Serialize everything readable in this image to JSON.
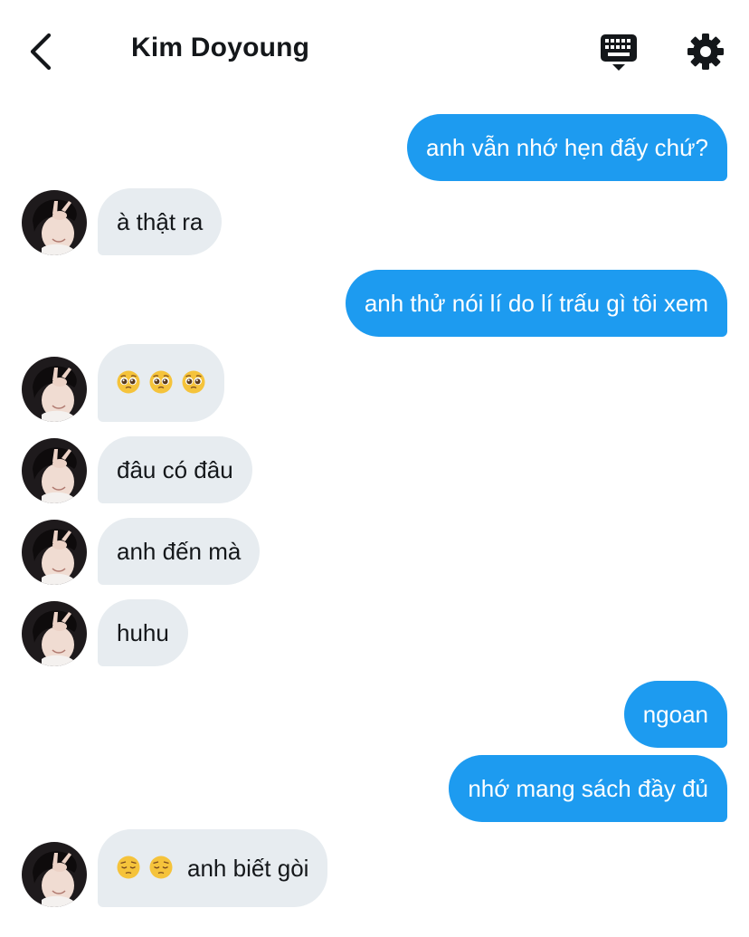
{
  "header": {
    "title": "Kim Doyoung",
    "back_icon": "chevron-left-icon",
    "keyboard_icon": "keyboard-icon",
    "settings_icon": "gear-icon"
  },
  "colors": {
    "outgoing_bubble": "#1d9bf0",
    "incoming_bubble": "#e7ecf0",
    "text_dark": "#14171a"
  },
  "messages": [
    {
      "direction": "outgoing",
      "text": "anh vẫn nhớ hẹn đấy chứ?"
    },
    {
      "direction": "incoming",
      "text": "à thật ra"
    },
    {
      "direction": "outgoing",
      "text": "anh thử nói lí do lí trấu gì tôi xem"
    },
    {
      "direction": "incoming",
      "emojis": [
        "pleading-face",
        "pleading-face",
        "pleading-face"
      ],
      "text": ""
    },
    {
      "direction": "incoming",
      "text": "đâu có đâu"
    },
    {
      "direction": "incoming",
      "text": "anh đến mà"
    },
    {
      "direction": "incoming",
      "text": "huhu"
    },
    {
      "direction": "outgoing",
      "text": "ngoan"
    },
    {
      "direction": "outgoing",
      "text": "nhớ mang sách đầy đủ"
    },
    {
      "direction": "incoming",
      "emojis": [
        "pensive-face",
        "pensive-face"
      ],
      "text": "anh biết gòi"
    }
  ]
}
